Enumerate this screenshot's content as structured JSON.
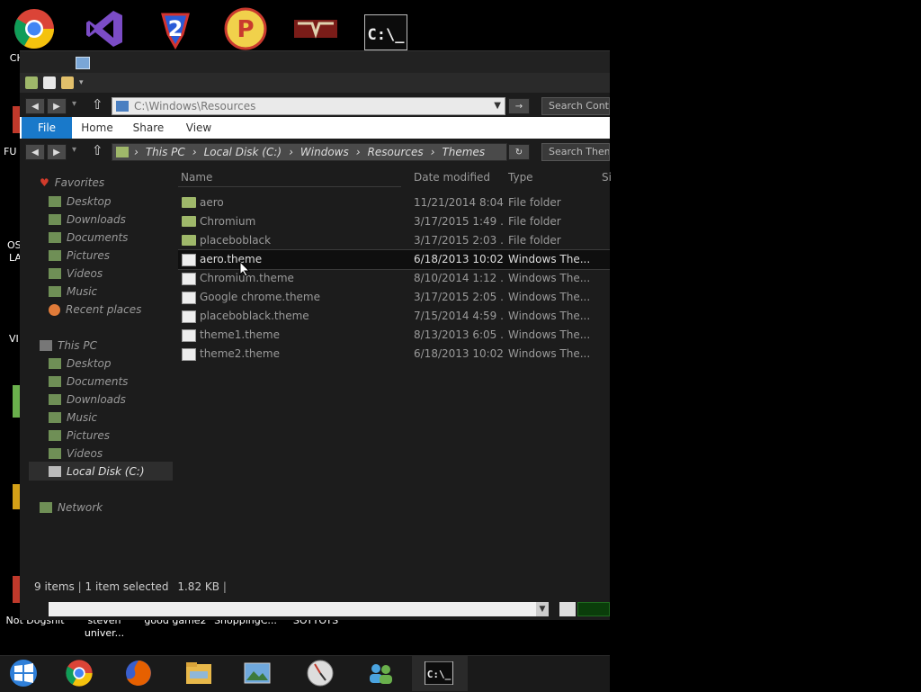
{
  "desktop": {
    "icons": [
      {
        "label": "CHRONES",
        "icon": "chrome-icon"
      },
      {
        "label": "",
        "icon": "visual-studio-icon"
      },
      {
        "label": "",
        "icon": "app-2-icon"
      },
      {
        "label": "",
        "icon": "pp-app-icon"
      },
      {
        "label": "",
        "icon": "papers-please-icon"
      },
      {
        "label": "",
        "icon": "cmd-icon"
      }
    ],
    "bottom_labels": [
      "Not Dogshit",
      "steven univer...",
      "good game2",
      "ShoppingC...",
      "SOYTOYS"
    ],
    "side_fragments": [
      "FU",
      "OS",
      "LA",
      "VI"
    ]
  },
  "window": {
    "address_upper": "C:\\Windows\\Resources",
    "search_upper": "Search Contr",
    "ribbon_tabs": [
      "File",
      "Home",
      "Share",
      "View"
    ],
    "breadcrumb": [
      "This PC",
      "Local Disk (C:)",
      "Windows",
      "Resources",
      "Themes"
    ],
    "search_lower": "Search Them",
    "nav": {
      "favorites_label": "Favorites",
      "favorites": [
        "Desktop",
        "Downloads",
        "Documents",
        "Pictures",
        "Videos",
        "Music",
        "Recent places"
      ],
      "thispc_label": "This PC",
      "thispc": [
        "Desktop",
        "Documents",
        "Downloads",
        "Music",
        "Pictures",
        "Videos",
        "Local Disk (C:)"
      ],
      "network_label": "Network"
    },
    "columns": {
      "name": "Name",
      "date": "Date modified",
      "type": "Type",
      "size": "Si"
    },
    "files": [
      {
        "name": "aero",
        "date": "11/21/2014 8:04...",
        "type": "File folder",
        "kind": "folder"
      },
      {
        "name": "Chromium",
        "date": "3/17/2015 1:49 ...",
        "type": "File folder",
        "kind": "folder"
      },
      {
        "name": "placeboblack",
        "date": "3/17/2015 2:03 ...",
        "type": "File folder",
        "kind": "folder"
      },
      {
        "name": "aero.theme",
        "date": "6/18/2013 10:02...",
        "type": "Windows The...",
        "kind": "theme"
      },
      {
        "name": "Chromium.theme",
        "date": "8/10/2014 1:12 ...",
        "type": "Windows The...",
        "kind": "theme"
      },
      {
        "name": "Google chrome.theme",
        "date": "3/17/2015 2:05 ...",
        "type": "Windows The...",
        "kind": "theme"
      },
      {
        "name": "placeboblack.theme",
        "date": "7/15/2014 4:59 ...",
        "type": "Windows The...",
        "kind": "theme"
      },
      {
        "name": "theme1.theme",
        "date": "8/13/2013 6:05 ...",
        "type": "Windows The...",
        "kind": "theme"
      },
      {
        "name": "theme2.theme",
        "date": "6/18/2013 10:02...",
        "type": "Windows The...",
        "kind": "theme"
      }
    ],
    "status": {
      "items": "9 items",
      "selected": "1 item selected",
      "size": "1.82 KB"
    }
  },
  "taskbar": {
    "icons": [
      "start-icon",
      "chrome-icon",
      "firefox-icon",
      "file-explorer-icon",
      "photo-viewer-icon",
      "clock-app-icon",
      "people-app-icon",
      "cmd-icon"
    ]
  },
  "colors": {
    "selection": "#0f0f0f",
    "ribbon_file_tab": "#1979ca",
    "folder": "#9fb86a"
  }
}
